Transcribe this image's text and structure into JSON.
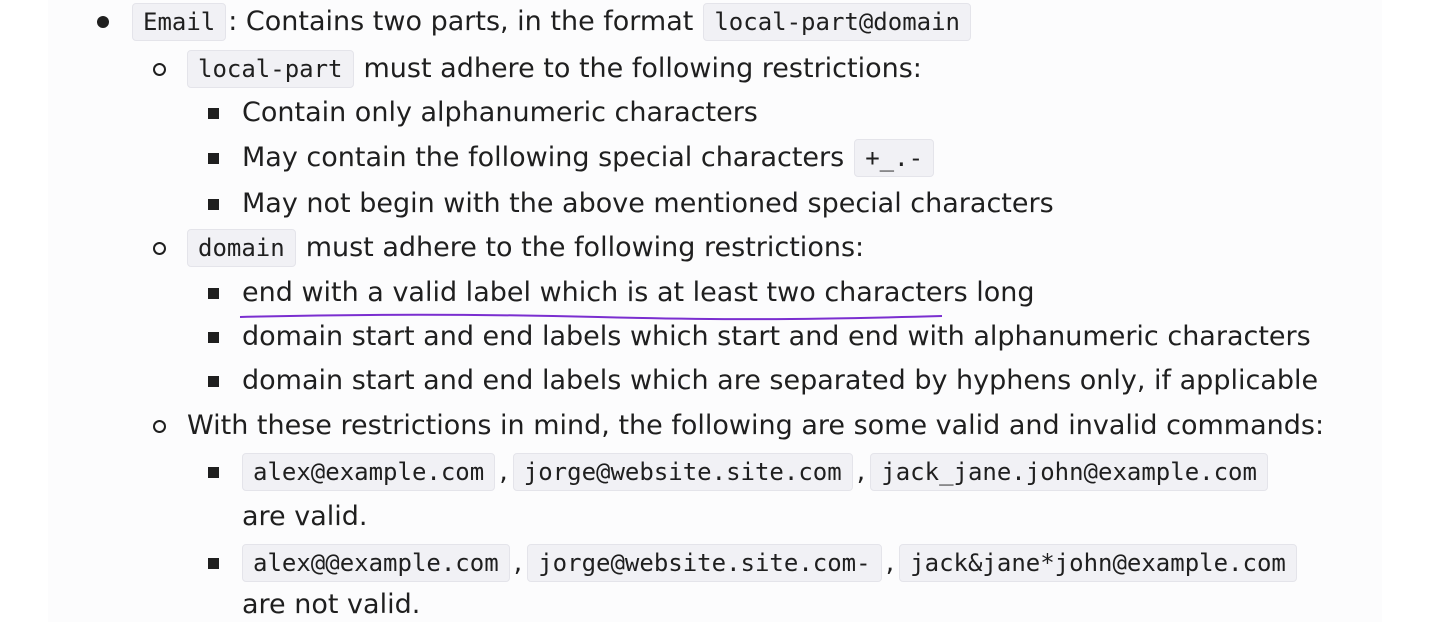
{
  "email_section": {
    "term": "Email",
    "intro": ": Contains two parts, in the format",
    "format": "local-part@domain",
    "local_part": {
      "code": "local-part",
      "text": "must adhere to the following restrictions:",
      "rules": [
        "Contain only alphanumeric characters",
        "May contain the following special characters",
        "May not begin with the above mentioned special characters"
      ],
      "special_chars": "+_.-"
    },
    "domain": {
      "code": "domain",
      "text": "must adhere to the following restrictions:",
      "rules": [
        "end with a valid label which is at least two characters long",
        "domain start and end labels which start and end with alphanumeric characters",
        "domain start and end labels which are separated by hyphens only, if applicable"
      ]
    },
    "examples": {
      "intro": "With these restrictions in mind, the following are some valid and invalid commands:",
      "valid": [
        "alex@example.com",
        "jorge@website.site.com",
        "jack_jane.john@example.com"
      ],
      "valid_suffix": "are valid.",
      "invalid": [
        "alex@@example.com",
        "jorge@website.site.com-",
        "jack&jane*john@example.com"
      ],
      "invalid_suffix": "are not valid.",
      "separator": ","
    }
  },
  "colors": {
    "spellcheck_underline": "#7b2fd0",
    "code_background": "#f1f1f5"
  }
}
